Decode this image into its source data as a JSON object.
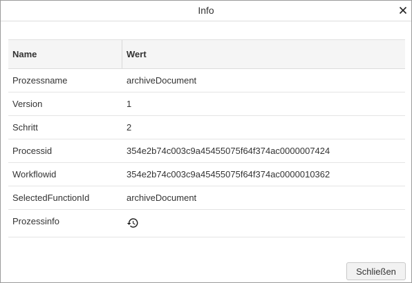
{
  "dialog": {
    "title": "Info",
    "close_icon": "close-icon",
    "close_button_label": "Schließen"
  },
  "table": {
    "columns": [
      "Name",
      "Wert"
    ],
    "rows": [
      {
        "name": "Prozessname",
        "value": "archiveDocument"
      },
      {
        "name": "Version",
        "value": "1"
      },
      {
        "name": "Schritt",
        "value": "2"
      },
      {
        "name": "Processid",
        "value": "354e2b74c003c9a45455075f64f374ac0000007424"
      },
      {
        "name": "Workflowid",
        "value": "354e2b74c003c9a45455075f64f374ac0000010362"
      },
      {
        "name": "SelectedFunctionId",
        "value": "archiveDocument"
      },
      {
        "name": "Prozessinfo",
        "value_icon": "history-icon"
      }
    ]
  }
}
